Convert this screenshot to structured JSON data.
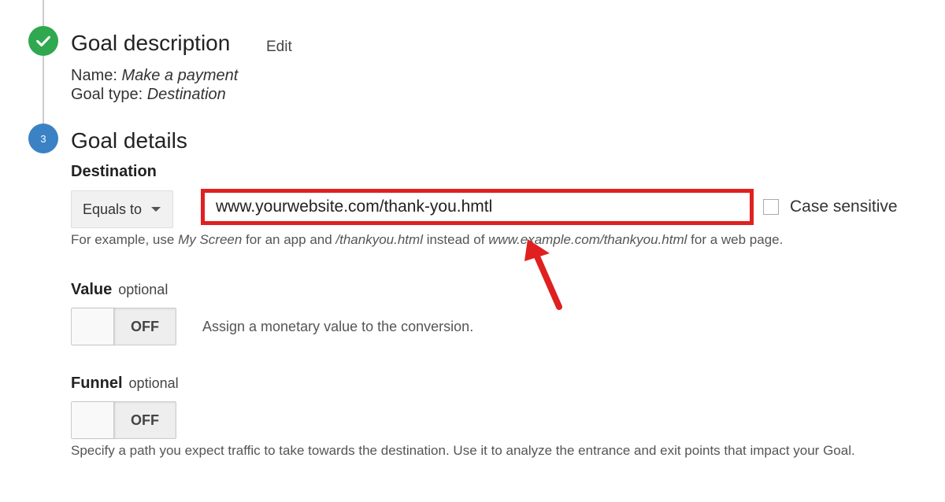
{
  "steps": {
    "description": {
      "title": "Goal description",
      "edit_label": "Edit",
      "name_label": "Name:",
      "name_value": "Make a payment",
      "type_label": "Goal type:",
      "type_value": "Destination"
    },
    "details": {
      "number": "3",
      "title": "Goal details"
    }
  },
  "destination": {
    "label": "Destination",
    "match_type": "Equals to",
    "url_value": "www.yourwebsite.com/thank-you.hmtl",
    "case_sensitive_label": "Case sensitive",
    "hint": {
      "p1": "For example, use ",
      "i1": "My Screen",
      "p2": " for an app and ",
      "i2": "/thankyou.html",
      "p3": " instead of ",
      "i3": "www.example.com/thankyou.html",
      "p4": " for a web page."
    }
  },
  "value": {
    "label": "Value",
    "optional": "optional",
    "toggle_state": "OFF",
    "description": "Assign a monetary value to the conversion."
  },
  "funnel": {
    "label": "Funnel",
    "optional": "optional",
    "toggle_state": "OFF",
    "description": "Specify a path you expect traffic to take towards the destination. Use it to analyze the entrance and exit points that impact your Goal."
  },
  "colors": {
    "highlight": "#e02020",
    "complete": "#2fa84f",
    "active_step": "#3b82c4"
  },
  "icons": [
    "checkmark-icon",
    "chevron-down-icon",
    "red-arrow-annotation"
  ]
}
